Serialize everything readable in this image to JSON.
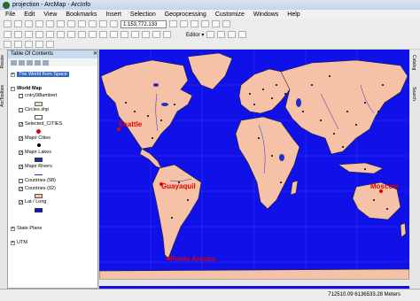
{
  "window": {
    "title": "projection - ArcMap - ArcInfo"
  },
  "menu": [
    "File",
    "Edit",
    "View",
    "Bookmarks",
    "Insert",
    "Selection",
    "Geoprocessing",
    "Customize",
    "Windows",
    "Help"
  ],
  "toolbar": {
    "scale": "1:153,772,133",
    "editor": "Editor ▾"
  },
  "toc": {
    "header": "Table Of Contents",
    "frame1": "The World from Space",
    "frame2": "World Map",
    "layers": {
      "l1": "cntry98lambert",
      "l2": "Circles.shp",
      "l3": "Selected_CITIES",
      "l4": "Major Cities",
      "l5": "Major Lakes",
      "l6": "Major Rivers",
      "l7": "Countries (98)",
      "l8": "Countries (92)",
      "l9": "Lat / Long"
    },
    "frame3": "State Plane",
    "frame4": "UTM"
  },
  "left_tabs": {
    "resize": "Resize",
    "toolbox": "ArcToolbox"
  },
  "right_tabs": {
    "catalog": "Catalog",
    "search": "Search"
  },
  "map": {
    "labels": {
      "seattle": "Seattle",
      "guayaquil": "Guayaquil",
      "punta": "Punta Arenas",
      "moscow": "Moscow"
    },
    "colors": {
      "ocean": "#1010e8",
      "land": "#f5c2a8",
      "cities": "#000000",
      "selected": "#e00000"
    }
  },
  "status": {
    "coordinates": "712510.09  6136533.28 Meters"
  }
}
